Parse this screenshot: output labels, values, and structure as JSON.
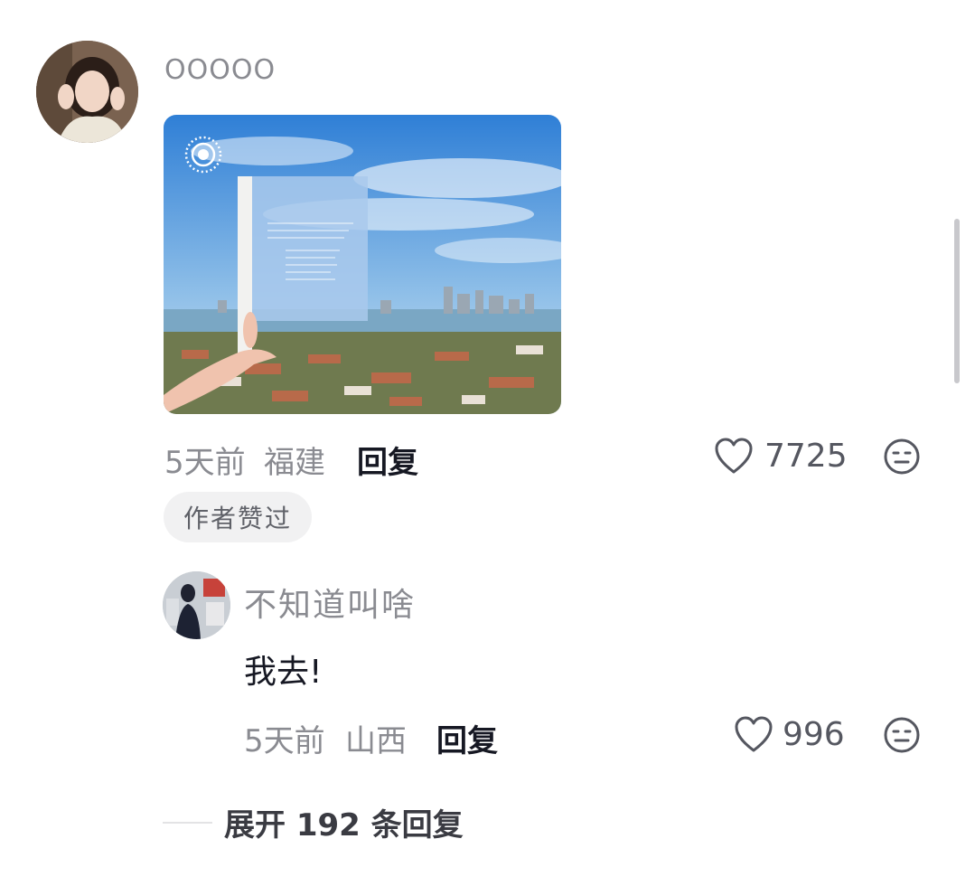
{
  "comment": {
    "username": "OOOOO",
    "time": "5天前",
    "location": "福建",
    "reply_label": "回复",
    "likes": "7725",
    "author_badge": "作者赞过"
  },
  "reply": {
    "username": "不知道叫啥",
    "text": "我去!",
    "time": "5天前",
    "location": "山西",
    "reply_label": "回复",
    "likes": "996"
  },
  "expand": {
    "label": "展开 192 条回复"
  },
  "icons": {
    "like": "heart-outline-icon",
    "dislike": "neutral-face-icon",
    "live_photo": "live-photo-icon"
  },
  "colors": {
    "secondary_text": "#8a8b91",
    "primary_text": "#161823",
    "badge_bg": "#f1f1f2"
  }
}
